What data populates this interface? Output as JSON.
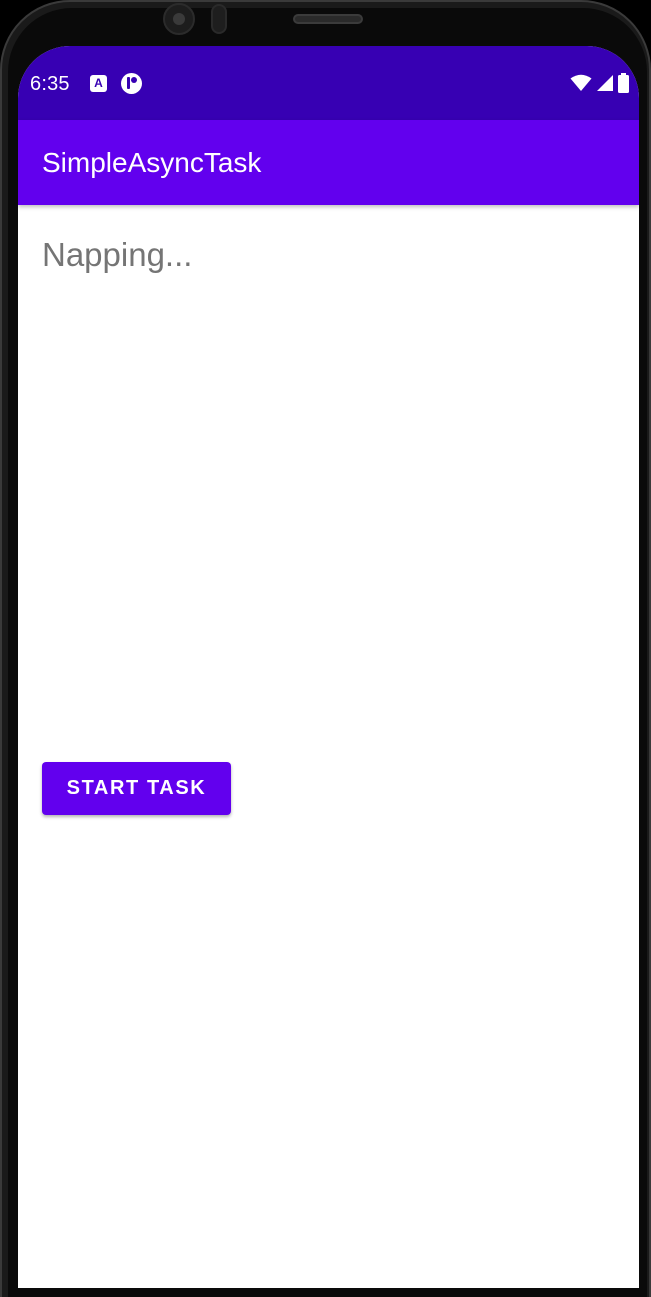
{
  "status_bar": {
    "time": "6:35",
    "notifications": [
      "a-notification-icon",
      "app-notification-icon"
    ],
    "system_icons": [
      "wifi-icon",
      "cell-signal-icon",
      "battery-icon"
    ],
    "background_color": "#3700B3"
  },
  "app_bar": {
    "title": "SimpleAsyncTask",
    "background_color": "#6200EE"
  },
  "main": {
    "status_text": "Napping...",
    "start_button_label": "START TASK",
    "accent_color": "#6200EE"
  }
}
